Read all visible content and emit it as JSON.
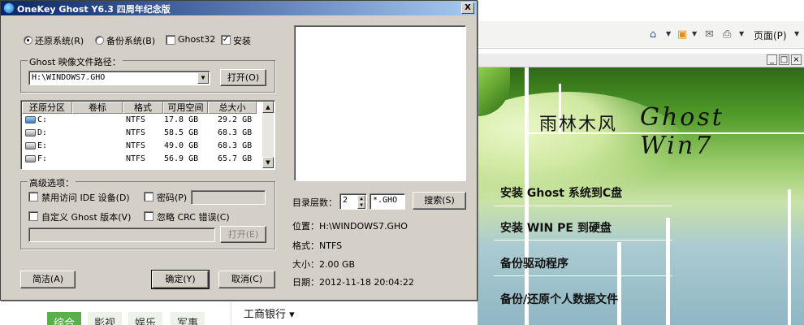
{
  "browser": {
    "toolbar": {
      "page_label": "页面(P)",
      "home_icon": "home-icon",
      "rss_icon": "rss-icon",
      "mail_icon": "mail-icon",
      "print_icon": "print-icon"
    },
    "splash": {
      "title_cn": "雨林木风",
      "title_ghost": "Ghost  Win7",
      "menu": [
        "安装 Ghost 系统到C盘",
        "安装 WIN PE 到硬盘",
        "备份驱动程序",
        "备份/还原个人数据文件"
      ],
      "accent_color": "#4f9a28"
    },
    "bottom_nav": {
      "tabs": [
        "综合",
        "影视",
        "娱乐",
        "军事"
      ],
      "active_tab": 0,
      "bank": "工商银行 ▾"
    }
  },
  "dialog": {
    "title": "OneKey Ghost Y6.3 四周年纪念版",
    "close_label": "X",
    "modes": {
      "restore": "还原系统(R)",
      "backup": "备份系统(B)",
      "ghost32": "Ghost32",
      "install": "安装",
      "selected": "restore"
    },
    "image_path_group": "Ghost 映像文件路径：",
    "image_path_value": "H:\\WINDOWS7.GHO",
    "open_button": "打开(O)",
    "table": {
      "columns": [
        "还原分区",
        "卷标",
        "格式",
        "可用空间",
        "总大小"
      ],
      "rows": [
        {
          "drive": "C:",
          "label": "",
          "format": "NTFS",
          "free": "17.8 GB",
          "total": "29.2 GB"
        },
        {
          "drive": "D:",
          "label": "",
          "format": "NTFS",
          "free": "58.5 GB",
          "total": "68.3 GB"
        },
        {
          "drive": "E:",
          "label": "",
          "format": "NTFS",
          "free": "49.0 GB",
          "total": "68.3 GB"
        },
        {
          "drive": "F:",
          "label": "",
          "format": "NTFS",
          "free": "56.9 GB",
          "total": "65.7 GB"
        }
      ]
    },
    "advanced": {
      "title": "高级选项：",
      "disable_ide": "禁用访问 IDE 设备(D)",
      "password": "密码(P)",
      "custom_ghost": "自定义 Ghost 版本(V)",
      "ignore_crc": "忽略 CRC 错误(C)",
      "open_button": "打开(E)"
    },
    "buttons": {
      "simple": "简洁(A)",
      "ok": "确定(Y)",
      "cancel": "取消(C)"
    },
    "search": {
      "depth_label": "目录层数：",
      "depth_value": "2",
      "pattern": "*.GHO",
      "search_button": "搜索(S)"
    },
    "info": {
      "location": "位置：H:\\WINDOWS7.GHO",
      "format": "格式：NTFS",
      "size": "大小：2.00 GB",
      "date": "日期：2012-11-18  20:04:22"
    }
  }
}
